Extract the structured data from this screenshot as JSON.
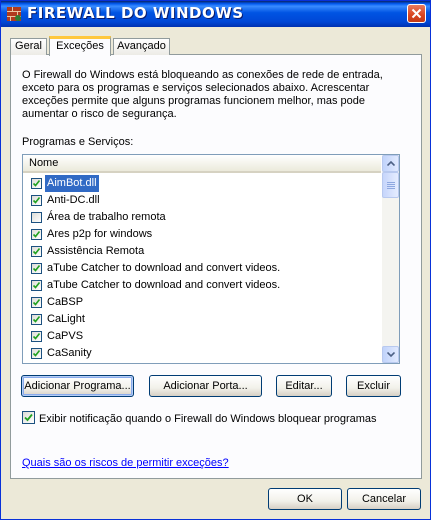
{
  "window": {
    "title": "FIREWALL DO WINDOWS"
  },
  "tabs": [
    {
      "label": "Geral"
    },
    {
      "label": "Exceções"
    },
    {
      "label": "Avançado"
    }
  ],
  "description": "O Firewall do Windows está bloqueando as conexões de rede de entrada, exceto para os programas e serviços selecionados abaixo. Acrescentar exceções permite que alguns programas funcionem melhor, mas pode aumentar o risco de segurança.",
  "programs": {
    "label": "Programas e Serviços:",
    "column_header": "Nome",
    "items": [
      {
        "label": "AimBot.dll",
        "checked": true,
        "selected": true
      },
      {
        "label": "Anti-DC.dll",
        "checked": true
      },
      {
        "label": "Área de trabalho remota",
        "checked": false
      },
      {
        "label": "Ares p2p for windows",
        "checked": true
      },
      {
        "label": "Assistência Remota",
        "checked": true
      },
      {
        "label": "aTube Catcher to download and convert videos.",
        "checked": true
      },
      {
        "label": "aTube Catcher to download and convert videos.",
        "checked": true
      },
      {
        "label": "CaBSP",
        "checked": true
      },
      {
        "label": "CaLight",
        "checked": true
      },
      {
        "label": "CaPVS",
        "checked": true
      },
      {
        "label": "CaSanity",
        "checked": true
      }
    ]
  },
  "buttons": {
    "add_program": "Adicionar Programa...",
    "add_port": "Adicionar Porta...",
    "edit": "Editar...",
    "delete": "Excluir",
    "ok": "OK",
    "cancel": "Cancelar"
  },
  "notify": {
    "label": "Exibir notificação quando o Firewall do Windows bloquear programas",
    "checked": true
  },
  "risk_link": "Quais são os riscos de permitir exceções?",
  "colors": {
    "title_blue": "#0054E3",
    "selection": "#316AC5",
    "face": "#ECE9D8",
    "link": "#0000FF"
  }
}
